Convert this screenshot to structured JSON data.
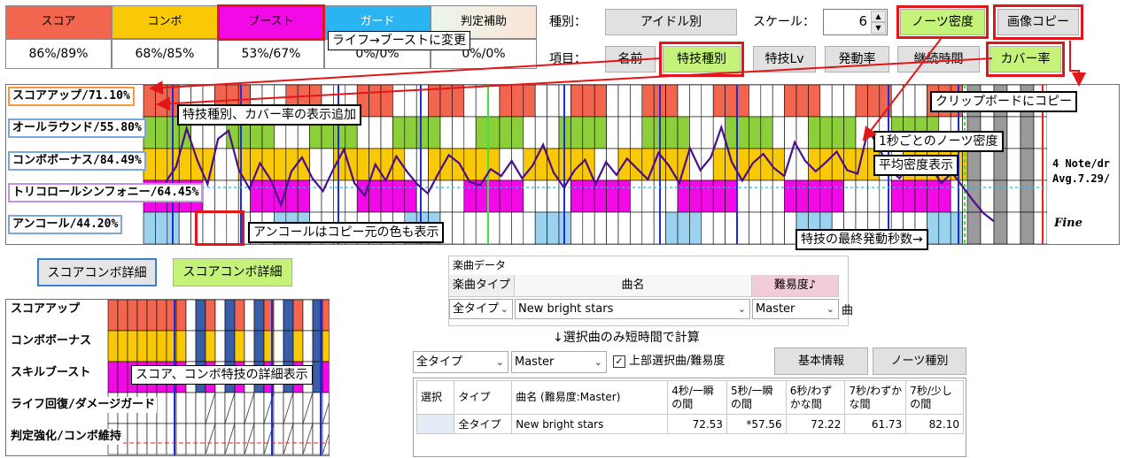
{
  "skill_types": [
    {
      "name": "スコア",
      "color": "#f26650",
      "value": "86%/89%"
    },
    {
      "name": "コンボ",
      "color": "#f9c908",
      "value": "68%/85%"
    },
    {
      "name": "ブースト",
      "color": "#f20ae6",
      "value": "53%/67%"
    },
    {
      "name": "ガード",
      "color": "#2ab4f2",
      "value": "0%/0%"
    },
    {
      "name": "判定補助",
      "color": "#d9ecd9",
      "value": "0%/0%"
    }
  ],
  "controls": {
    "type_label": "種別：",
    "type_button": "アイドル別",
    "scale_label": "スケール：",
    "scale_value": "6",
    "notes_density_button": "ノーツ密度",
    "copy_image_button": "画像コピー",
    "item_label": "項目：",
    "item_buttons": [
      "名前",
      "特技種別",
      "特技Lv",
      "発動率",
      "継続時間",
      "カバー率"
    ]
  },
  "annotations": {
    "life_to_boost": "ライフ→ブーストに変更",
    "skill_type_cover": "特技種別、カバー率の表示追加",
    "clipboard": "クリップボードにコピー",
    "density_1s": "1秒ごとのノーツ密度",
    "avg_density": "平均密度表示",
    "encore": "アンコールはコピー元の色も表示",
    "last_activation": "特技の最終発動秒数→",
    "detail_display": "スコア、コンボ特技の詳細表示",
    "select_only": "↓選択曲のみ短時間で計算"
  },
  "chart": {
    "rows": [
      "スコアアップ/71.10%",
      "オールラウンド/55.80%",
      "コンボボーナス/84.49%",
      "トリコロールシンフォニー/64.45%",
      "アンコール/44.20%"
    ],
    "density_text_1": "4 Note/dr",
    "density_text_2": "Avg.7.29/",
    "fine_label": "Fine",
    "density_series": [
      5.2,
      6.5,
      9.8,
      7.1,
      5.0,
      8.9,
      9.6,
      6.2,
      4.6,
      6.8,
      5.4,
      3.2,
      6.1,
      7.3,
      5.5,
      4.4,
      6.3,
      8.0,
      5.1,
      4.0,
      6.7,
      5.3,
      7.4,
      6.1,
      5.0,
      4.2,
      5.9,
      7.5,
      6.8,
      5.2,
      4.9,
      6.3,
      5.7,
      7.0,
      5.5,
      6.6,
      8.4,
      6.0,
      4.7,
      6.2,
      7.1,
      5.0,
      6.9,
      5.8,
      7.2,
      6.3,
      5.4,
      7.7,
      6.6,
      5.1,
      8.1,
      6.2,
      7.3,
      9.9,
      6.9,
      5.3,
      6.8,
      7.6,
      6.4,
      5.7,
      8.6,
      7.0,
      6.1,
      6.9,
      7.8,
      6.2,
      5.9,
      9.7,
      8.2,
      6.3,
      5.5,
      6.8,
      5.9,
      6.4,
      5.1,
      6.0,
      4.8,
      3.6,
      2.5,
      1.8
    ]
  },
  "detail_buttons": {
    "left": "スコアコンボ詳細",
    "right": "スコアコンボ詳細"
  },
  "detail": {
    "rows": [
      "スコアアップ",
      "コンボボーナス",
      "スキルブースト",
      "ライフ回復/ダメージガード",
      "判定強化/コンボ維持"
    ]
  },
  "song_data": {
    "group_title": "楽曲データ",
    "headers": [
      "楽曲タイプ",
      "曲名",
      "難易度♪"
    ],
    "type_select": "全タイプ",
    "song_select": "New bright stars",
    "difficulty_select": "Master",
    "extra_col": "曲"
  },
  "filters": {
    "type": "全タイプ",
    "difficulty": "Master",
    "checkbox_label": "上部選択曲/難易度",
    "checkbox_checked": "✓",
    "basic_info_button": "基本情報",
    "note_type_button": "ノーツ種別"
  },
  "results": {
    "headers": [
      "選択",
      "タイプ",
      "曲名 (難易度:Master)",
      "4秒/一瞬の間",
      "5秒/一瞬の間",
      "6秒/わずかな間",
      "7秒/わずかな間",
      "7秒/少しの間"
    ],
    "rows": [
      {
        "select": "",
        "type": "全タイプ",
        "song": "New bright stars",
        "v1": "72.53",
        "v2": "*57.56",
        "v3": "72.22",
        "v4": "61.73",
        "v5": "82.10"
      }
    ]
  },
  "colors": {
    "accent_red": "#e0161b",
    "button_green": "#c5f37a",
    "score": "#f26650",
    "combo": "#f9c908",
    "boost": "#f20ae6",
    "allround": "#8ccf3a",
    "encore_blue": "#9bd2f0",
    "line": "#4b0d8c",
    "marker_blue": "#1e2bd8",
    "marker_green": "#3de23d",
    "marker_red": "#e8201c"
  }
}
